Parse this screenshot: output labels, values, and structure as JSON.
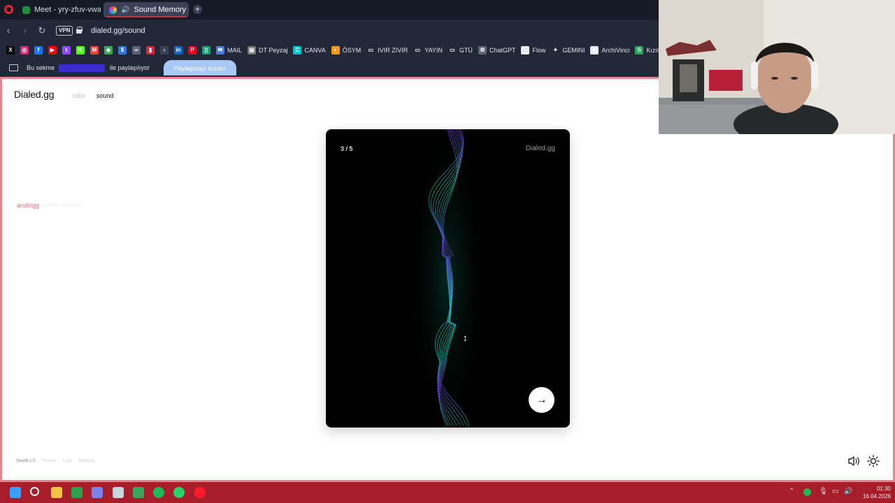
{
  "browser": {
    "tabs": [
      {
        "title": "Meet - yry-zfuv-vwa",
        "active": false,
        "icon": "meet-icon"
      },
      {
        "title": "Sound Memory Game",
        "active": true,
        "icon": "speaker-icon"
      }
    ],
    "url": "dialed.gg/sound",
    "vpn_label": "VPN",
    "bookmarks": [
      {
        "label": "",
        "icon": "x-icon",
        "color": "#000000",
        "glyph": "X"
      },
      {
        "label": "",
        "icon": "instagram-icon",
        "color": "#d62976",
        "glyph": "◎"
      },
      {
        "label": "",
        "icon": "facebook-icon",
        "color": "#1877f2",
        "glyph": "f"
      },
      {
        "label": "",
        "icon": "youtube-icon",
        "color": "#ff0000",
        "glyph": "▶"
      },
      {
        "label": "",
        "icon": "twitch-icon",
        "color": "#9146ff",
        "glyph": "t"
      },
      {
        "label": "",
        "icon": "kick-icon",
        "color": "#53fc18",
        "glyph": "K"
      },
      {
        "label": "",
        "icon": "gmail-icon",
        "color": "#ea4335",
        "glyph": "M"
      },
      {
        "label": "",
        "icon": "maps-icon",
        "color": "#34a853",
        "glyph": "◆"
      },
      {
        "label": "",
        "icon": "dollar-icon",
        "color": "#2a7ae2",
        "glyph": "$"
      },
      {
        "label": "",
        "icon": "link-icon",
        "color": "#5b6275",
        "glyph": "∞"
      },
      {
        "label": "",
        "icon": "app-icon",
        "color": "#d4283f",
        "glyph": "▮"
      },
      {
        "label": "",
        "icon": "nav-icon",
        "color": "#3a4055",
        "glyph": "›"
      },
      {
        "label": "",
        "icon": "linkedin-icon",
        "color": "#0a66c2",
        "glyph": "in"
      },
      {
        "label": "",
        "icon": "pinterest-icon",
        "color": "#e60023",
        "glyph": "P"
      },
      {
        "label": "",
        "icon": "phone-icon",
        "color": "#1aa37a",
        "glyph": "▯"
      },
      {
        "label": "MAIL",
        "icon": "mail-icon",
        "color": "#4a7bd6",
        "glyph": "✉"
      },
      {
        "label": "DT Peyzaj",
        "icon": "doc-icon",
        "color": "#777777",
        "glyph": "▤"
      },
      {
        "label": "CANVA",
        "icon": "canva-icon",
        "color": "#00c4cc",
        "glyph": "C"
      },
      {
        "label": "ÖSYM",
        "icon": "osym-icon",
        "color": "#f29a1c",
        "glyph": "◐"
      },
      {
        "label": "IVIR ZIVIR",
        "icon": "folder-icon",
        "color": "#232838",
        "glyph": "▭"
      },
      {
        "label": "YAYIN",
        "icon": "folder-icon",
        "color": "#232838",
        "glyph": "▭"
      },
      {
        "label": "GTÜ",
        "icon": "folder-icon",
        "color": "#232838",
        "glyph": "▭"
      },
      {
        "label": "ChatGPT",
        "icon": "chatgpt-icon",
        "color": "#5f6675",
        "glyph": "⚙"
      },
      {
        "label": "Flow",
        "icon": "flow-icon",
        "color": "#e9ebf1",
        "glyph": ""
      },
      {
        "label": "GEMINI",
        "icon": "gemini-icon",
        "color": "#232838",
        "glyph": "✦"
      },
      {
        "label": "ArchiVinci",
        "icon": "archivinci-icon",
        "color": "#e9ebf1",
        "glyph": "A"
      },
      {
        "label": "Kızıl Da",
        "icon": "kizil-icon",
        "color": "#2aa55a",
        "glyph": "S"
      }
    ],
    "share": {
      "prefix": "Bu sekme",
      "suffix": "ile paylaşılıyor",
      "stop_button": "Paylaşmayı durdur"
    }
  },
  "site": {
    "logo": "Dialed.gg",
    "nav": {
      "color": "color",
      "sound": "sound"
    },
    "user": {
      "name": "arulingg",
      "subtitle": "sesleri anlamak"
    }
  },
  "card": {
    "progress": "3 / 5",
    "brand": "Dialed.gg",
    "next_icon": "arrow-right-icon"
  },
  "footer": {
    "version": "Sound 1.0",
    "links": [
      "Privacy",
      "Lists",
      "Blocking"
    ]
  },
  "taskbar": {
    "clock_time": "01:30",
    "clock_date": "16.04.2026",
    "apps": [
      {
        "icon": "windows-icon",
        "color": "#3aa0ff"
      },
      {
        "icon": "search-icon",
        "color": "#ffffff"
      },
      {
        "icon": "file-explorer-icon",
        "color": "#f4c542"
      },
      {
        "icon": "xbox-icon",
        "color": "#30a14e"
      },
      {
        "icon": "teams-icon",
        "color": "#7b83eb"
      },
      {
        "icon": "steam-icon",
        "color": "#c7d5e0"
      },
      {
        "icon": "discord-icon",
        "color": "#3ba55d"
      },
      {
        "icon": "spotify-icon",
        "color": "#1db954"
      },
      {
        "icon": "whatsapp-icon",
        "color": "#25d366"
      },
      {
        "icon": "opera-icon",
        "color": "#ff1b2d"
      }
    ]
  },
  "colors": {
    "page_border": "#e8848f",
    "taskbar": "#a71d2a",
    "accent_tab": "#d4283f",
    "wave_teal": "#1fd1a6",
    "wave_purple": "#7b3ff2"
  }
}
